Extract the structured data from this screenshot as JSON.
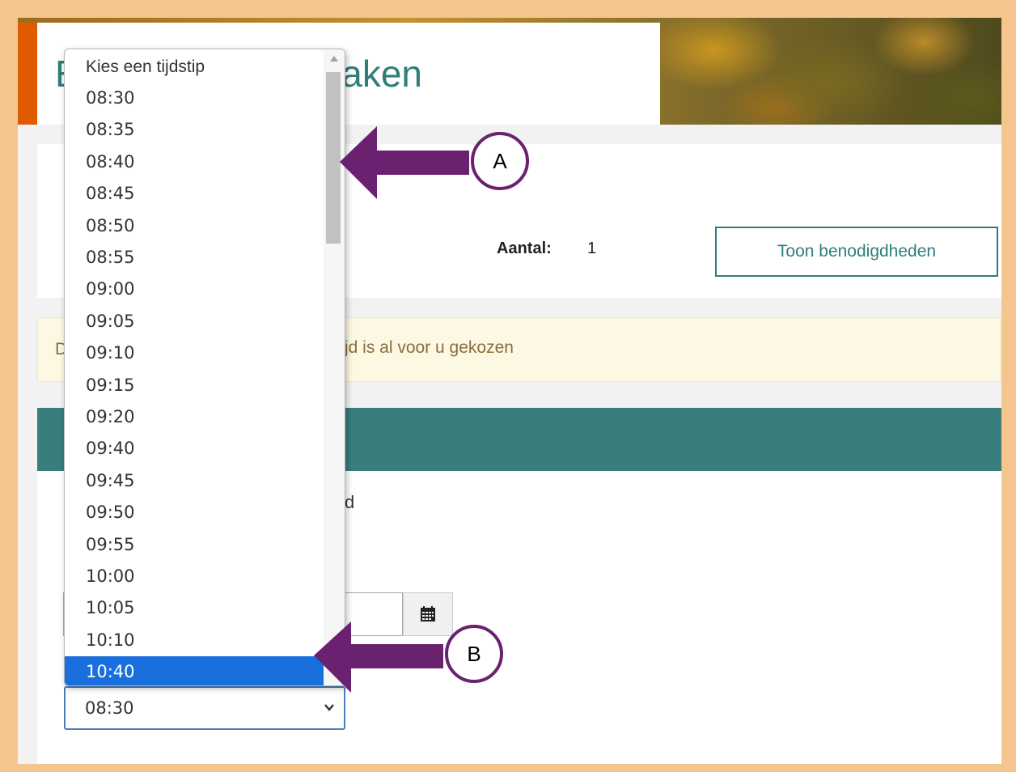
{
  "page": {
    "title_visible": "E",
    "title_visible_2": "naken"
  },
  "summary": {
    "quantity_label": "Aantal:",
    "quantity_value": "1",
    "show_button_label": "Toon benodigdheden"
  },
  "notice": {
    "leading_letter": "D",
    "text": "jd is al voor u gekozen"
  },
  "form": {
    "partial_label": "d",
    "selected_value": "08:30"
  },
  "dropdown": {
    "placeholder": "Kies een tijdstip",
    "options": [
      "08:30",
      "08:35",
      "08:40",
      "08:45",
      "08:50",
      "08:55",
      "09:00",
      "09:05",
      "09:10",
      "09:15",
      "09:20",
      "09:40",
      "09:45",
      "09:50",
      "09:55",
      "10:00",
      "10:05",
      "10:10",
      "10:40"
    ],
    "highlighted": "10:40"
  },
  "annotations": {
    "callout_a": "A",
    "callout_b": "B",
    "arrow_color": "#6a2170"
  },
  "colors": {
    "teal": "#377e7d",
    "accent_orange": "#e05a00",
    "selection_blue": "#1a6fde",
    "frame": "#f5c58e"
  }
}
